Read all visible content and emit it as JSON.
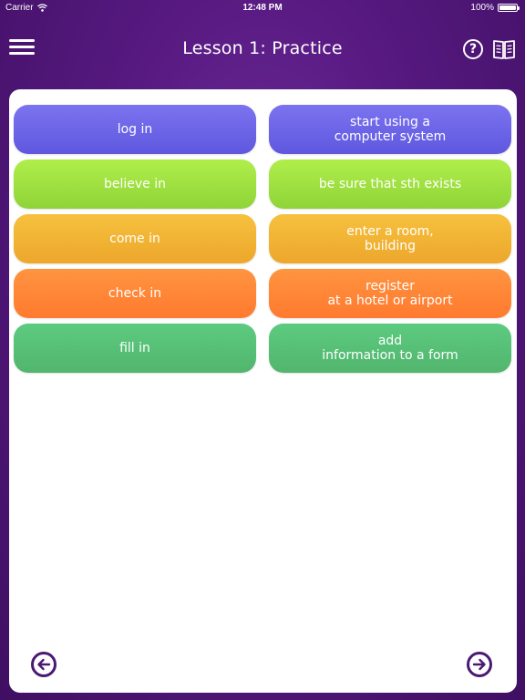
{
  "status": {
    "carrier": "Carrier",
    "time": "12:48 PM",
    "battery": "100%"
  },
  "header": {
    "title": "Lesson 1: Practice",
    "menu_icon": "hamburger-menu-icon",
    "help_label": "?",
    "help_icon": "help-circle-icon",
    "book_icon": "open-book-icon"
  },
  "tiles": {
    "left": [
      {
        "text": "log in",
        "color": "#6c65e8"
      },
      {
        "text": "believe in",
        "color": "#9fe042"
      },
      {
        "text": "come in",
        "color": "#f1b436"
      },
      {
        "text": "check in",
        "color": "#ff8638"
      },
      {
        "text": "fill in",
        "color": "#56c076"
      }
    ],
    "right": [
      {
        "text": "start using a\ncomputer system",
        "color": "#6c65e8"
      },
      {
        "text": "be sure that sth exists",
        "color": "#9fe042"
      },
      {
        "text": "enter a room,\nbuilding",
        "color": "#f1b436"
      },
      {
        "text": "register\nat a hotel or airport",
        "color": "#ff8638"
      },
      {
        "text": "add\ninformation to a form",
        "color": "#56c076"
      }
    ]
  },
  "footer": {
    "prev_icon": "arrow-left-circle-icon",
    "next_icon": "arrow-right-circle-icon"
  },
  "colors": {
    "background": "#56197f",
    "card": "#ffffff",
    "arrow": "#4a1a73"
  }
}
